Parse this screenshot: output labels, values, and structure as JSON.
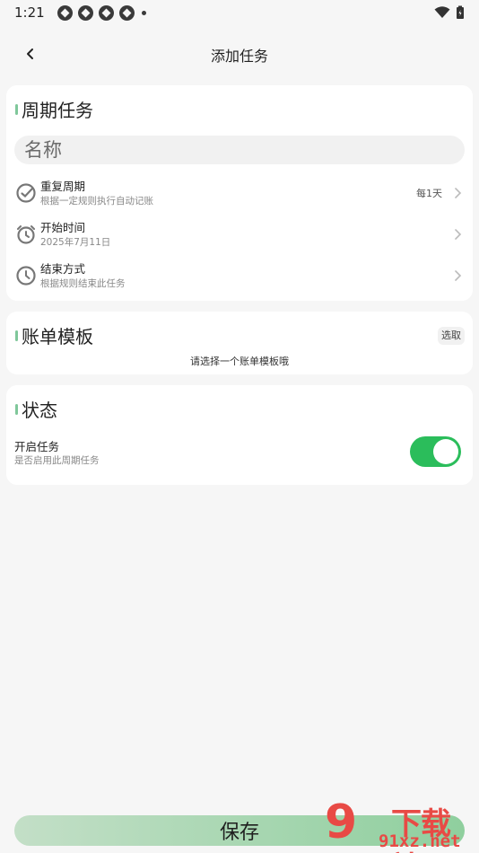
{
  "status_bar": {
    "time": "1:21"
  },
  "header": {
    "title": "添加任务"
  },
  "periodic_card": {
    "title": "周期任务",
    "name_placeholder": "名称",
    "rows": [
      {
        "title": "重复周期",
        "subtitle": "根据一定规则执行自动记账",
        "value": "每1天",
        "icon": "check-circle-icon"
      },
      {
        "title": "开始时间",
        "subtitle": "2025年7月11日",
        "value": "",
        "icon": "alarm-clock-icon"
      },
      {
        "title": "结束方式",
        "subtitle": "根据规则结束此任务",
        "value": "",
        "icon": "clock-icon"
      }
    ]
  },
  "template_card": {
    "title": "账单模板",
    "pick_label": "选取",
    "hint": "请选择一个账单模板哦"
  },
  "status_card": {
    "title": "状态",
    "toggle_title": "开启任务",
    "toggle_subtitle": "是否启用此周期任务",
    "toggle_on": true
  },
  "footer": {
    "save_label": "保存"
  },
  "watermark": {
    "text": "下载站",
    "url": "91xz.net",
    "digit": "9"
  },
  "colors": {
    "accent": "#2bbd5b",
    "title_bar": "#7fc79a",
    "watermark": "#e84a45"
  }
}
